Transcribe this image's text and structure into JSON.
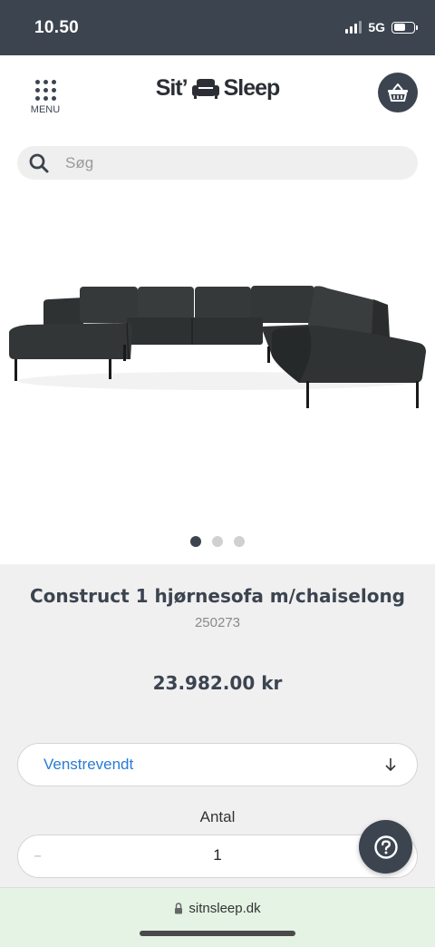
{
  "status_bar": {
    "time": "10.50",
    "network": "5G",
    "battery_level": 0.6
  },
  "header": {
    "menu_label": "MENU",
    "logo_left": "Sit’",
    "logo_right": "Sleep",
    "menu_icon": "grid-dots-icon",
    "cart_icon": "basket-icon"
  },
  "search": {
    "placeholder": "Søg",
    "icon": "search-icon"
  },
  "gallery": {
    "image_subject": "dark grey U-shaped corner sofa with chaise longue",
    "slide_count": 3,
    "active_slide": 1
  },
  "product": {
    "title": "Construct 1 hjørnesofa m/chaiselong",
    "sku": "250273",
    "price": "23.982.00 kr"
  },
  "variant": {
    "selected": "Venstrevendt",
    "icon": "arrow-down-icon"
  },
  "quantity": {
    "label": "Antal",
    "value": "1",
    "minus": "–"
  },
  "help": {
    "icon": "question-mark-icon"
  },
  "browser": {
    "url": "sitnsleep.dk",
    "lock_icon": "lock-icon"
  },
  "colors": {
    "primary": "#3c4450",
    "link": "#2a7bd2",
    "url_bar": "#e4f3e4"
  }
}
